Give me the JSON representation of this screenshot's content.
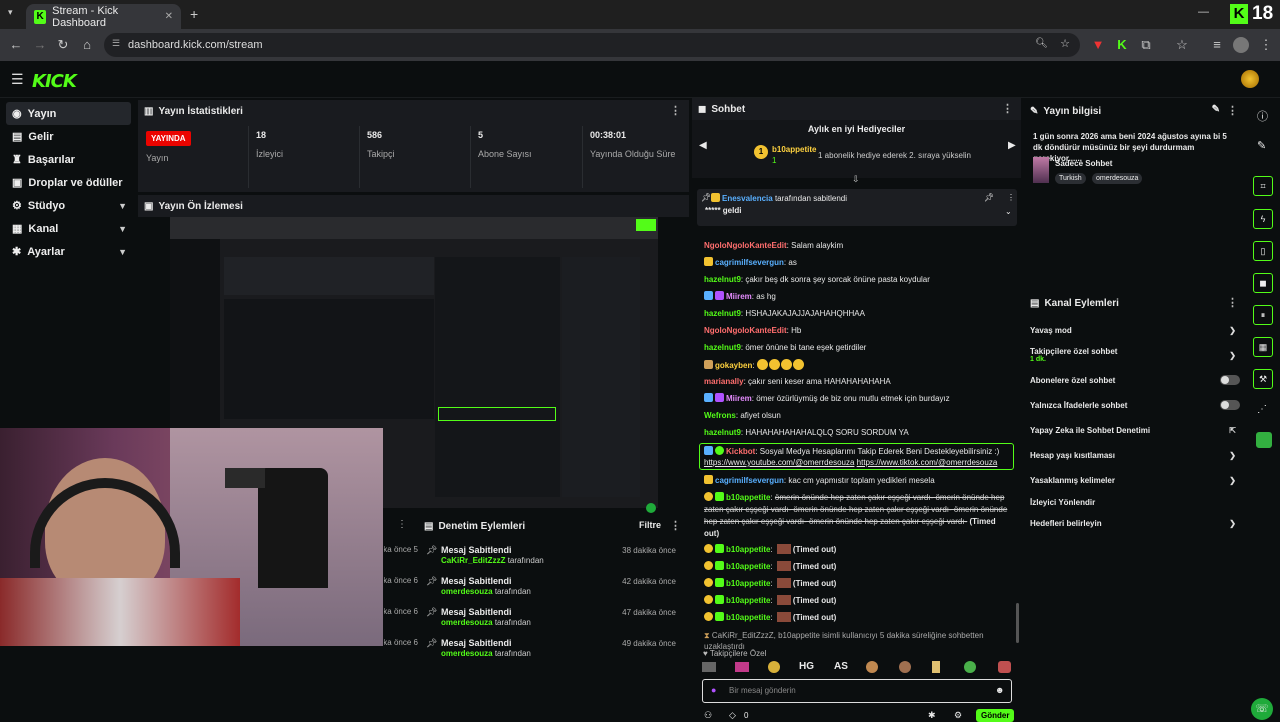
{
  "browser": {
    "tab_title": "Stream - Kick Dashboard",
    "url": "dashboard.kick.com/stream",
    "overlay_badge": "18"
  },
  "kick": {
    "logo": "KICK"
  },
  "sidebar": {
    "items": [
      {
        "label": "Yayın",
        "icon": "broadcast-icon",
        "active": true
      },
      {
        "label": "Gelir",
        "icon": "wallet-icon"
      },
      {
        "label": "Başarılar",
        "icon": "trophy-icon"
      },
      {
        "label": "Droplar ve ödüller",
        "icon": "gift-icon"
      },
      {
        "label": "Stüdyo",
        "icon": "studio-icon",
        "expandable": true
      },
      {
        "label": "Kanal",
        "icon": "channel-icon",
        "expandable": true
      },
      {
        "label": "Ayarlar",
        "icon": "settings-icon",
        "expandable": true
      }
    ]
  },
  "stats": {
    "title": "Yayın İstatistikleri",
    "live_badge": "YAYINDA",
    "live_label": "Yayın",
    "items": [
      {
        "value": "18",
        "label": "İzleyici"
      },
      {
        "value": "586",
        "label": "Takipçi"
      },
      {
        "value": "5",
        "label": "Abone Sayısı"
      },
      {
        "value": "00:38:01",
        "label": "Yayında Olduğu Süre"
      }
    ]
  },
  "preview": {
    "title": "Yayın Ön İzlemesi"
  },
  "moderation": {
    "title": "Denetim Eylemleri",
    "filter": "Filtre",
    "peek_times": [
      "5 dakika önce",
      "6 dakika önce",
      "6 dakika önce",
      "6 dakika önce"
    ],
    "items": [
      {
        "action": "Mesaj Sabitlendi",
        "user": "CaKiRr_EditZzzZ",
        "suffix": "tarafından",
        "time": "38 dakika önce"
      },
      {
        "action": "Mesaj Sabitlendi",
        "user": "omerdesouza",
        "suffix": "tarafından",
        "time": "42 dakika önce"
      },
      {
        "action": "Mesaj Sabitlendi",
        "user": "omerdesouza",
        "suffix": "tarafından",
        "time": "47 dakika önce"
      },
      {
        "action": "Mesaj Sabitlendi",
        "user": "omerdesouza",
        "suffix": "tarafından",
        "time": "49 dakika önce"
      }
    ]
  },
  "chat": {
    "title": "Sohbet",
    "gifter_title": "Aylık en iyi Hediyeciler",
    "gifter_name": "b10appetite",
    "gifter_count": "1",
    "gifter_note": "1 abonelik hediye ederek 2. sıraya yükselin",
    "pinned_user": "Enesvalencia",
    "pinned_by": "tarafından sabitlendi",
    "pinned_text": "***** geldi",
    "messages": [
      {
        "user": "NgoloNgoloKanteEdit",
        "text": "Salam alaykim",
        "cls": "u5"
      },
      {
        "user": "cagrimilfsevergun",
        "text": "as",
        "cls": "u4"
      },
      {
        "user": "hazelnut9",
        "text": "çakır beş dk sonra şey sorcak önüne pasta koydular",
        "cls": "u1"
      },
      {
        "user": "Miirem",
        "text": "as hg",
        "cls": "u3"
      },
      {
        "user": "hazelnut9",
        "text": "HSHAJAKAJAJJAJAHAHQHHAA",
        "cls": "u1"
      },
      {
        "user": "NgoloNgoloKanteEdit",
        "text": "Hb",
        "cls": "u5"
      },
      {
        "user": "hazelnut9",
        "text": "ömer önüne bi tane eşek getirdiler",
        "cls": "u1"
      },
      {
        "user": "gokayben",
        "text": "",
        "cls": "u6"
      },
      {
        "user": "marianally",
        "text": "çakır seni keser ama HAHAHAHAHAHA",
        "cls": "u5"
      },
      {
        "user": "Miirem",
        "text": "ömer özürlüymüş de biz onu mutlu etmek için burdayız",
        "cls": "u3"
      },
      {
        "user": "Wefrons",
        "text": "afiyet olsun",
        "cls": "u1"
      },
      {
        "user": "hazelnut9",
        "text": "HAHAHAHAHAHALQLQ SORU SORDUM YA",
        "cls": "u1"
      }
    ],
    "highlight": {
      "user": "Kickbot",
      "text": "Sosyal Medya Hesaplarımı Takip Ederek Beni Destekleyebilirsiniz :)",
      "link1": "https://www.youtube.com/@omerrdesouza",
      "link2": "https://www.tiktok.com/@omerrdesouza"
    },
    "msg_after": {
      "user": "cagrimilfsevergun",
      "text": "kac cm yapmıstır toplam yedikleri mesela"
    },
    "deleted": {
      "user": "b10appetite",
      "text": "ömerin önünde hep zaten çakır eşşeği vardı- ömerin önünde hep zaten çakır eşşeği vardı- ömerin önünde hep zaten çakır eşşeği vardı- ömerin önünde hep zaten çakır eşşeği vardı- ömerin önünde hep zaten çakır eşşeği vardı-",
      "status": "(Timed out)"
    },
    "timed_out_user": "b10appetite",
    "timed_out_label": "(Timed out)",
    "system": "CaKiRr_EditZzzZ, b10appetite isimli kullanıcıyı 5 dakika süreliğine sohbetten uzaklaştırdı",
    "mode_label": "Takipçilere Özel",
    "emote_labels": [
      "HG",
      "AS"
    ],
    "input_placeholder": "Bir mesaj gönderin",
    "points": "0",
    "send_label": "Gönder"
  },
  "stream_info": {
    "title": "Yayın bilgisi",
    "stream_title": "1 gün sonra 2026 ama beni 2024 ağustos ayına bi 5 dk döndürür müsünüz bir şeyi durdurmam gerekiyor......",
    "category": "Sadece Sohbet",
    "tags": [
      "Turkish",
      "omerdesouza"
    ]
  },
  "channel_actions": {
    "title": "Kanal Eylemleri",
    "items": [
      {
        "label": "Yavaş mod",
        "control": "arrow"
      },
      {
        "label": "Takipçilere özel sohbet",
        "sub": "1 dk.",
        "control": "arrow"
      },
      {
        "label": "Abonelere özel sohbet",
        "control": "toggle"
      },
      {
        "label": "Yalnızca İfadelerle sohbet",
        "control": "toggle"
      },
      {
        "label": "Yapay Zeka ile Sohbet Denetimi",
        "control": "external"
      },
      {
        "label": "Hesap yaşı kısıtlaması",
        "control": "arrow"
      },
      {
        "label": "Yasaklanmış kelimeler",
        "control": "arrow"
      },
      {
        "label": "İzleyici Yönlendir",
        "control": "none"
      },
      {
        "label": "Hedefleri belirleyin",
        "control": "arrow"
      }
    ]
  },
  "colors": {
    "accent": "#53fc18",
    "live": "#eb0400",
    "panel": "#191b1f",
    "bg": "#0b0e0f"
  }
}
